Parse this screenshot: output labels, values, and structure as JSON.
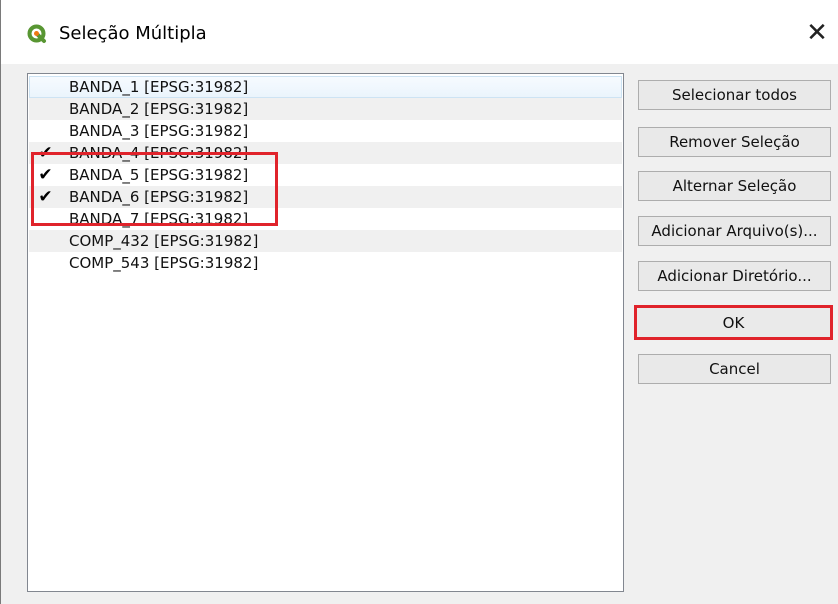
{
  "dialog": {
    "title": "Seleção Múltipla",
    "close_glyph": "✕",
    "app_icon": "qgis-logo-icon"
  },
  "list": {
    "items": [
      {
        "label": "BANDA_1 [EPSG:31982]",
        "checked": false
      },
      {
        "label": "BANDA_2 [EPSG:31982]",
        "checked": false
      },
      {
        "label": "BANDA_3 [EPSG:31982]",
        "checked": false
      },
      {
        "label": "BANDA_4 [EPSG:31982]",
        "checked": true
      },
      {
        "label": "BANDA_5 [EPSG:31982]",
        "checked": true
      },
      {
        "label": "BANDA_6 [EPSG:31982]",
        "checked": true
      },
      {
        "label": "BANDA_7 [EPSG:31982]",
        "checked": false
      },
      {
        "label": "COMP_432 [EPSG:31982]",
        "checked": false
      },
      {
        "label": "COMP_543 [EPSG:31982]",
        "checked": false
      }
    ],
    "check_glyph": "✔"
  },
  "buttons": {
    "select_all": "Selecionar todos",
    "remove_selection": "Remover Seleção",
    "toggle_selection": "Alternar Seleção",
    "add_files": "Adicionar Arquivo(s)...",
    "add_directory": "Adicionar Diretório...",
    "ok": "OK",
    "cancel": "Cancel"
  },
  "colors": {
    "annotation_red": "#e0232b",
    "qgis_green": "#589632",
    "qgis_yellow": "#ee7913"
  }
}
